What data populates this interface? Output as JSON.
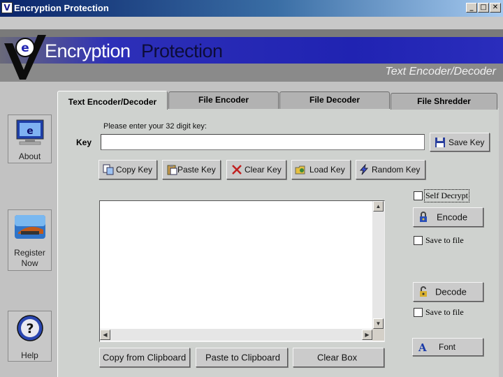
{
  "window": {
    "title": "Encryption Protection",
    "minimize": "_",
    "maximize": "□",
    "close": "✕"
  },
  "banner": {
    "brand_part1": "Encryption",
    "brand_part2": "Protection",
    "subtitle": "Text Encoder/Decoder"
  },
  "sidebar": {
    "about": "About",
    "register": "Register Now",
    "help": "Help"
  },
  "tabs": [
    {
      "label": "Text Encoder/Decoder",
      "active": true
    },
    {
      "label": "File Encoder",
      "active": false
    },
    {
      "label": "File Decoder",
      "active": false
    },
    {
      "label": "File Shredder",
      "active": false
    }
  ],
  "key": {
    "hint": "Please enter your 32 digit key:",
    "label": "Key",
    "value": "",
    "save_label": "Save Key"
  },
  "key_buttons": {
    "copy": "Copy Key",
    "paste": "Paste Key",
    "clear": "Clear Key",
    "load": "Load Key",
    "random": "Random Key"
  },
  "right_panel": {
    "self_decrypt": "Self Decrypt",
    "encode": "Encode",
    "save_to_file_encode": "Save to file",
    "decode": "Decode",
    "save_to_file_decode": "Save to file",
    "font": "Font"
  },
  "textarea": {
    "value": ""
  },
  "bottom_buttons": {
    "copy_from_clipboard": "Copy from Clipboard",
    "paste_to_clipboard": "Paste to Clipboard",
    "clear_box": "Clear Box"
  },
  "colors": {
    "banner_blue": "#2023b2",
    "panel_gray": "#cfd2cf",
    "titlebar": "#0a246a"
  }
}
